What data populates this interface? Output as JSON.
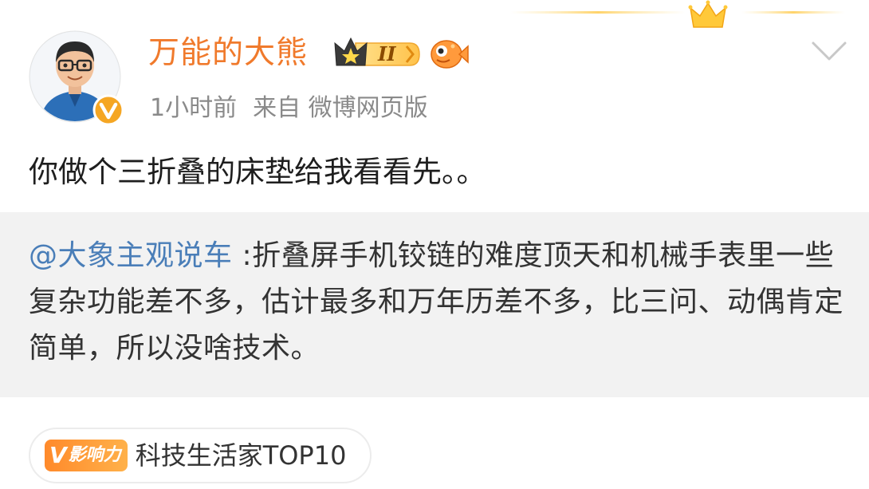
{
  "post": {
    "author": {
      "name": "万能的大熊",
      "member_level": "II",
      "verified": true
    },
    "meta": {
      "time": "1小时前",
      "source_prefix": "来自",
      "source": "微博网页版"
    },
    "text": "你做个三折叠的床垫给我看看先。。",
    "quote": {
      "mention": "@大象主观说车",
      "text": " :折叠屏手机铰链的难度顶天和机械手表里一些复杂功能差不多，估计最多和万年历差不多，比三问、动偶肯定简单，所以没啥技术。"
    },
    "influence": {
      "badge_letter": "V",
      "badge_label": "影响力",
      "text": "科技生活家TOP10"
    }
  },
  "colors": {
    "username": "#f07a2c",
    "mention": "#4a7eb8",
    "meta": "#8a8a8a",
    "quote_bg": "#f2f2f2",
    "verified_badge": "#f5a623"
  },
  "icons": {
    "avatar": "cartoon-avatar",
    "member_badge": "crown-member-badge",
    "fish_badge": "fish-badge-icon",
    "verified": "verified-v-icon",
    "chevron": "chevron-down-icon",
    "top_crown": "crown-icon"
  }
}
